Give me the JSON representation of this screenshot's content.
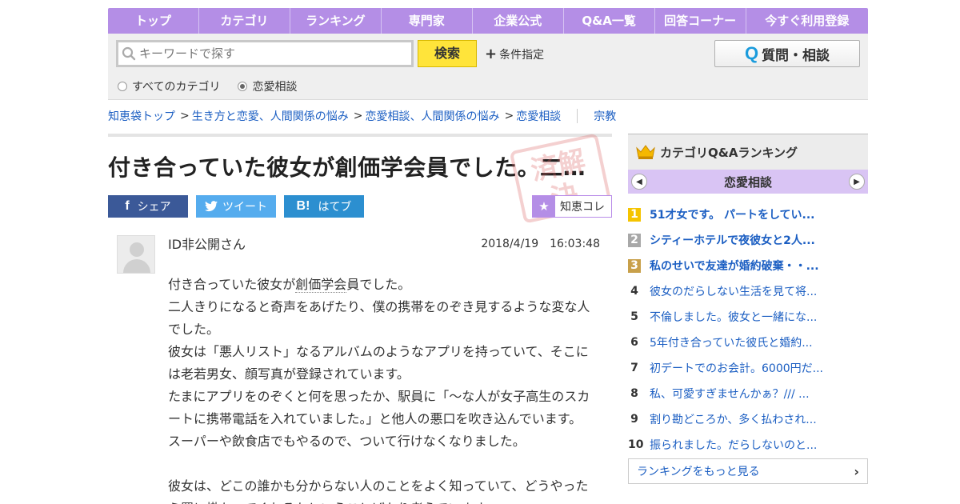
{
  "nav": {
    "items": [
      "トップ",
      "カテゴリ",
      "ランキング",
      "専門家",
      "企業公式",
      "Q&A一覧",
      "回答コーナー",
      "今すぐ利用登録"
    ]
  },
  "search": {
    "placeholder": "キーワードで探す",
    "button": "検索",
    "conditions": "条件指定",
    "ask_button": "質問・相談",
    "ask_icon": "Q",
    "radio_all": "すべてのカテゴリ",
    "radio_current": "恋愛相談",
    "selected": "恋愛相談"
  },
  "breadcrumb": {
    "items": [
      "知恵袋トップ",
      "生き方と恋愛、人間関係の悩み",
      "恋愛相談、人間関係の悩み",
      "恋愛相談"
    ],
    "separator": ">",
    "related": "宗教"
  },
  "question": {
    "title": "付き合っていた彼女が創価学会員でした。二…",
    "stamp": "済解 決",
    "share": {
      "facebook": "シェア",
      "twitter": "ツイート",
      "hatena": "はてブ",
      "collection": "知恵コレ"
    },
    "user": "ID非公開さん",
    "date": "2018/4/19　16:03:48",
    "body": {
      "l1_pre": "付き合っていた彼女が",
      "l1_kw": "創価学会",
      "l1_post": "員でした。",
      "l2": "二人きりになると奇声をあげたり、僕の携帯をのぞき見するような変な人",
      "l3": "でした。",
      "l4": "彼女は「悪人リスト」なるアルバムのようなアプリを持っていて、そこに",
      "l5": "は老若男女、顔写真が登録されています。",
      "l6": "たまにアプリをのぞくと何を思ったか、駅員に「～な人が女子高生のスカ",
      "l7": "ートに携帯電話を入れていました。」と他人の悪口を吹き込んでいます。",
      "l8": "スーパーや飲食店でもやるので、ついて行けなくなりました。",
      "l9": "彼女は、どこの誰かも分からない人のことをよく知っていて、どうやった",
      "l10": "ら罠に掛かってくれるかということばかり考えています。"
    }
  },
  "sidebar": {
    "heading": "カテゴリQ&Aランキング",
    "category": "恋愛相談",
    "ranking": [
      {
        "num": "1",
        "text": "51才女です。 パートをしてい..."
      },
      {
        "num": "2",
        "text": "シティーホテルで夜彼女と2人..."
      },
      {
        "num": "3",
        "text": "私のせいで友達が婚約破棄・・..."
      },
      {
        "num": "4",
        "text": "彼女のだらしない生活を見て将..."
      },
      {
        "num": "5",
        "text": "不倫しました。彼女と一緒にな..."
      },
      {
        "num": "6",
        "text": "5年付き合っていた彼氏と婚約..."
      },
      {
        "num": "7",
        "text": "初デートでのお会計。6000円だ..."
      },
      {
        "num": "8",
        "text": "私、可愛すぎませんかぁ？/// ..."
      },
      {
        "num": "9",
        "text": "割り勘どころか、多く払わされ..."
      },
      {
        "num": "10",
        "text": "振られました。だらしないのと..."
      }
    ],
    "more": "ランキングをもっと見る"
  }
}
